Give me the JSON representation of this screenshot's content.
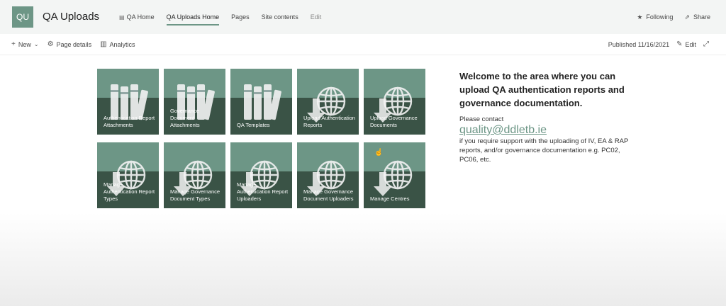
{
  "header": {
    "logo_text": "QU",
    "site_title": "QA Uploads",
    "nav": [
      {
        "label": "QA Home"
      },
      {
        "label": "QA Uploads Home"
      },
      {
        "label": "Pages"
      },
      {
        "label": "Site contents"
      },
      {
        "label": "Edit"
      }
    ],
    "following_label": "Following",
    "share_label": "Share"
  },
  "commandbar": {
    "new_label": "New",
    "page_details_label": "Page details",
    "analytics_label": "Analytics",
    "published_text": "Published 11/16/2021",
    "edit_label": "Edit"
  },
  "tiles": [
    {
      "label": "Authentication Report Attachments",
      "icon": "books-icon"
    },
    {
      "label": "Governance Document Attachments",
      "icon": "books-icon"
    },
    {
      "label": "QA Templates",
      "icon": "books-icon"
    },
    {
      "label": "Upload Authentication Reports",
      "icon": "globe-arrow-icon"
    },
    {
      "label": "Upload Governance Documents",
      "icon": "globe-arrow-icon"
    },
    {
      "label": "Manage Authentication Report Types",
      "icon": "globe-arrow-icon"
    },
    {
      "label": "Manage Governance Document Types",
      "icon": "globe-arrow-icon"
    },
    {
      "label": "Manage Authentication Report Uploaders",
      "icon": "globe-arrow-icon"
    },
    {
      "label": "Manage Governance Document Uploaders",
      "icon": "globe-arrow-icon"
    },
    {
      "label": "Manage Centres",
      "icon": "globe-arrow-icon"
    }
  ],
  "welcome": {
    "heading": "Welcome to the area where you can upload QA authentication reports and governance documentation.",
    "contact_prefix": "Please contact",
    "email": "quality@ddletb.ie",
    "contact_suffix": "if you require support with the uploading of IV, EA & RAP reports, and/or governance documentation e.g. PC02, PC06, etc."
  },
  "colors": {
    "accent": "#6d9686",
    "tile_dark": "#3a5346"
  }
}
